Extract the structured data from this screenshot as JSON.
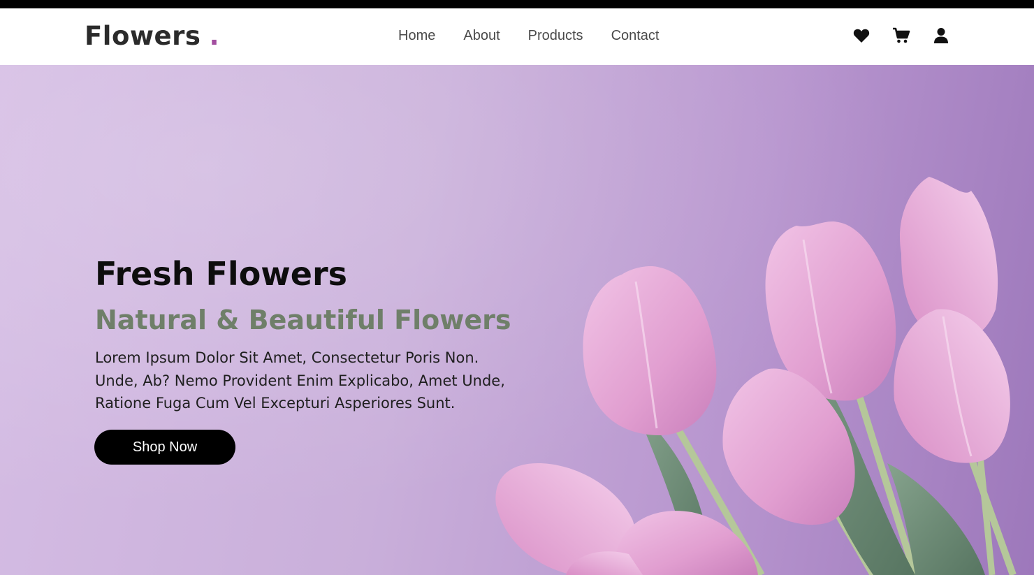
{
  "header": {
    "logo_text": "Flowers",
    "logo_dot": ".",
    "nav": [
      {
        "label": "Home"
      },
      {
        "label": "About"
      },
      {
        "label": "Products"
      },
      {
        "label": "Contact"
      }
    ],
    "icons": [
      "heart-icon",
      "cart-icon",
      "user-icon"
    ]
  },
  "hero": {
    "title": "Fresh Flowers",
    "subtitle": "Natural & Beautiful Flowers",
    "text_lines": [
      "Lorem Ipsum Dolor Sit Amet, Consectetur Poris Non.",
      "Unde, Ab? Nemo Provident Enim Explicabo, Amet Unde,",
      "Ratione Fuga Cum Vel Excepturi Asperiores Sunt."
    ],
    "button_label": "Shop Now"
  },
  "colors": {
    "logo_dot": "#a34fa0",
    "subtitle": "#6f7f69",
    "button_bg": "#000000",
    "hero_bg": "#c8add9",
    "tulip": "#e6a6d6",
    "leaf": "#6f8f78"
  }
}
